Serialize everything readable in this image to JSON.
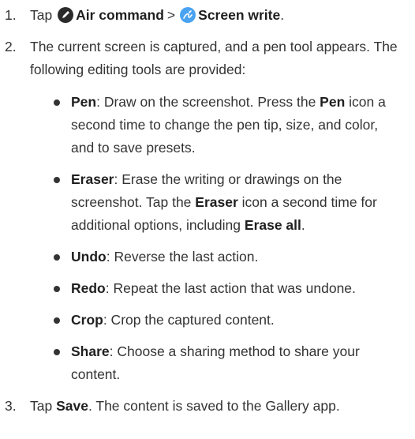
{
  "steps": [
    {
      "number": "1.",
      "text_before": "Tap",
      "item1": "Air command",
      "separator": ">",
      "item2": "Screen write",
      "end": "."
    },
    {
      "number": "2.",
      "text": "The current screen is captured, and a pen tool appears. The following editing tools are provided:",
      "tools": [
        {
          "parts": [
            {
              "t": "Pen",
              "b": true
            },
            {
              "t": ": Draw on the screenshot. Press the "
            },
            {
              "t": "Pen",
              "b": true
            },
            {
              "t": " icon a second time to change the pen tip, size, and color, and to save presets."
            }
          ]
        },
        {
          "parts": [
            {
              "t": "Eraser",
              "b": true
            },
            {
              "t": ": Erase the writing or drawings on the screenshot. Tap the "
            },
            {
              "t": "Eraser",
              "b": true
            },
            {
              "t": " icon a second time for additional options, including "
            },
            {
              "t": "Erase all",
              "b": true
            },
            {
              "t": "."
            }
          ]
        },
        {
          "parts": [
            {
              "t": "Undo",
              "b": true
            },
            {
              "t": ": Reverse the last action."
            }
          ]
        },
        {
          "parts": [
            {
              "t": "Redo",
              "b": true
            },
            {
              "t": ": Repeat the last action that was undone."
            }
          ]
        },
        {
          "parts": [
            {
              "t": "Crop",
              "b": true
            },
            {
              "t": ": Crop the captured content."
            }
          ]
        },
        {
          "parts": [
            {
              "t": "Share",
              "b": true
            },
            {
              "t": ": Choose a sharing method to share your content."
            }
          ]
        }
      ]
    },
    {
      "number": "3.",
      "text_before": "Tap",
      "bold": "Save",
      "text_after": ". The content is saved to the Gallery app."
    }
  ],
  "icons": {
    "air_command": {
      "name": "air-command-icon",
      "color": "#2b2b2b"
    },
    "screen_write": {
      "name": "screen-write-icon",
      "color": "#4aa3f0"
    }
  }
}
